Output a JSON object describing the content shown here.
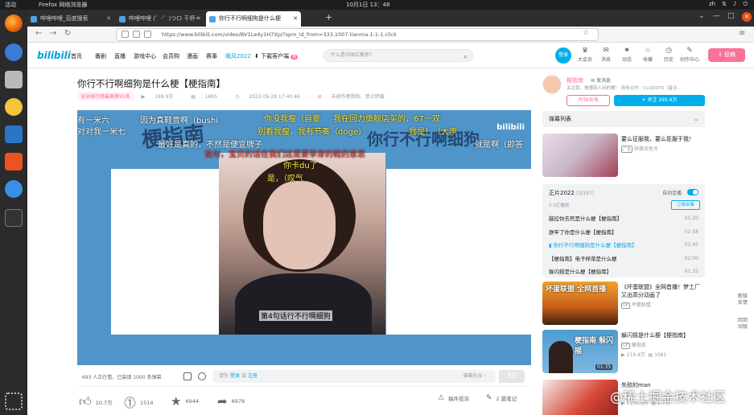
{
  "os": {
    "activities": "活动",
    "app": "Firefox 网络浏览器",
    "clock": "10月1日  13：48",
    "lang": "zh",
    "icons": [
      "network-icon",
      "volume-icon",
      "power-icon"
    ]
  },
  "browser": {
    "tabs": [
      {
        "title": "哔哩哔哩_百度搜索",
        "active": false
      },
      {
        "title": "哔哩哔哩 (゜-゜)つロ 干杯~",
        "active": false
      },
      {
        "title": "你行不行啊细狗是什么梗",
        "active": true
      }
    ],
    "url": "https://www.bilibili.com/video/BV1Le4y1H7Xp/?spm_id_from=333.1007.tianma.1-1-1.click"
  },
  "site": {
    "logo": "bilibili",
    "nav": [
      "首页",
      "番剧",
      "直播",
      "游戏中心",
      "会员购",
      "漫画",
      "赛事",
      "晚风2022",
      "下载客户端"
    ],
    "download_badge": "新",
    "search_placeholder": "什么是中国式教养？",
    "login": "登录",
    "icons": [
      {
        "label": "大会员",
        "icon": "vip-icon"
      },
      {
        "label": "消息",
        "icon": "message-icon"
      },
      {
        "label": "动态",
        "icon": "dynamic-icon"
      },
      {
        "label": "收藏",
        "icon": "favorite-icon"
      },
      {
        "label": "历史",
        "icon": "history-icon"
      },
      {
        "label": "创作中心",
        "icon": "creation-icon"
      }
    ],
    "upload": "投稿"
  },
  "video": {
    "title": "你行不行啊细狗是什么梗【梗指南】",
    "rank": "全站排行榜最高第91名",
    "views": "199.9万",
    "danmaku": "1665",
    "date": "2022-09-28 17:40:46",
    "copyright": "未经作者授权，禁止转载",
    "player": {
      "banner_left": "梗指南",
      "banner_right": "你行不行啊细狗",
      "watermark": "bilibili",
      "subtitle": "第4句话行不行啊细狗",
      "danmaku_lines": [
        {
          "text": "有一米六",
          "color": "#ffffff"
        },
        {
          "text": "对对我一米七",
          "color": "#ffffff"
        },
        {
          "text": "因为真鞋贵啊（bushi",
          "color": "#ffffff"
        },
        {
          "text": "你没我瘦（自豪",
          "color": "#ffeb3b"
        },
        {
          "text": "我在回力旗舰店买的，67一双",
          "color": "#ffeb3b"
        },
        {
          "text": "别看我瘦，我有节奏（doge）",
          "color": "#ffeb3b"
        },
        {
          "text": "我是！（大声",
          "color": "#ffeb3b"
        },
        {
          "text": "就是啊（即答",
          "color": "#ffffff"
        },
        {
          "text": "最好是真的，不然是便宜牌子",
          "color": "#ffffff"
        },
        {
          "text": "说句，宝贝的话在我们这是要季穿的鞋的意思",
          "color": "#e53935"
        },
        {
          "text": "你卡du了",
          "color": "#ffeb3b"
        },
        {
          "text": "是，（叹气",
          "color": "#ffeb3b"
        }
      ]
    },
    "dmbar": {
      "count": "693 人正在看，已装填 1000 条弹幕",
      "prompt_pre": "请先",
      "login": "登录",
      "or": "或",
      "register": "注册",
      "gift": "弹幕礼仪 ›",
      "send": "发送"
    },
    "toolbar": {
      "like": "10.7万",
      "coin": "1514",
      "favorite": "6944",
      "share": "6978",
      "report": "稿件投诉",
      "notes": "2 篇笔记"
    }
  },
  "up": {
    "name": "梗指南",
    "message": "发消息",
    "desc": "关注我，看懂别人玩的梗！  商务合作：CLQDST8（备注…",
    "charge": "为TA充电",
    "follow": "+ 关注 295.6万"
  },
  "danmaku_list": "弹幕列表",
  "recommend_top": {
    "title": "要么征服我，要么臣服于我！",
    "owner": "祥蛋名危令",
    "owner_tag": "广告"
  },
  "playlist": {
    "title": "正片2022",
    "progress": "(3/197)",
    "sub": "3.3亿播放",
    "autoplay": "自动连播",
    "subscribe": "订阅合集",
    "episodes": [
      {
        "title": "脑控你去死是什么梗【梗指南】",
        "duration": "01:20",
        "current": false
      },
      {
        "title": "朕牢了你是什么梗【梗指南】",
        "duration": "02:58",
        "current": false
      },
      {
        "title": "你行不行啊细狗是什么梗【梗指南】",
        "duration": "01:45",
        "current": true
      },
      {
        "title": "【梗指南】电子榨菜是什么梗",
        "duration": "02:00",
        "current": false
      },
      {
        "title": "躲闪摇是什么梗【梗指南】",
        "duration": "01:35",
        "current": false
      }
    ]
  },
  "recommend": [
    {
      "title": "《坏蛋联盟》全网首播！梦工厂又出高分动画了",
      "owner": "坏蛋联盟",
      "thumb_text": "坏蛋联盟 全网首播",
      "duration": ""
    },
    {
      "title": "躲闪摇是什么梗【梗指南】",
      "owner": "梗指南",
      "views": "219.4万",
      "danmaku": "1061",
      "thumb_text": "梗指南 躲闪摇",
      "duration": "01:35"
    },
    {
      "title": "失败的man",
      "owner": "",
      "views": "1100.5万",
      "danmaku": "1.7万",
      "duration": ""
    }
  ],
  "side_float": [
    "新版",
    "反馈",
    "回到",
    "旧版"
  ],
  "watermark": "@稀土掘金技术社区"
}
